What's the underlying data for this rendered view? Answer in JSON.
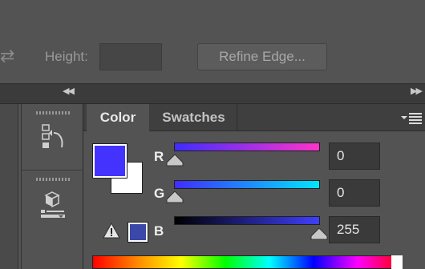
{
  "options_bar": {
    "height_label": "Height:",
    "height_value": "",
    "refine_button": "Refine Edge..."
  },
  "panel": {
    "tabs": [
      {
        "label": "Color",
        "active": true
      },
      {
        "label": "Swatches",
        "active": false
      }
    ],
    "foreground_color": "#4433ff",
    "background_color": "#ffffff",
    "gamut_warning_color": "#3a48a8"
  },
  "channels": [
    {
      "label": "R",
      "value": "0"
    },
    {
      "label": "G",
      "value": "0"
    },
    {
      "label": "B",
      "value": "255"
    }
  ],
  "icons": {
    "swap": "swap-arrows-icon",
    "history": "history-icon",
    "properties": "3d-cube-icon",
    "warning": "out-of-gamut-warning-icon",
    "menu": "panel-menu-icon"
  }
}
